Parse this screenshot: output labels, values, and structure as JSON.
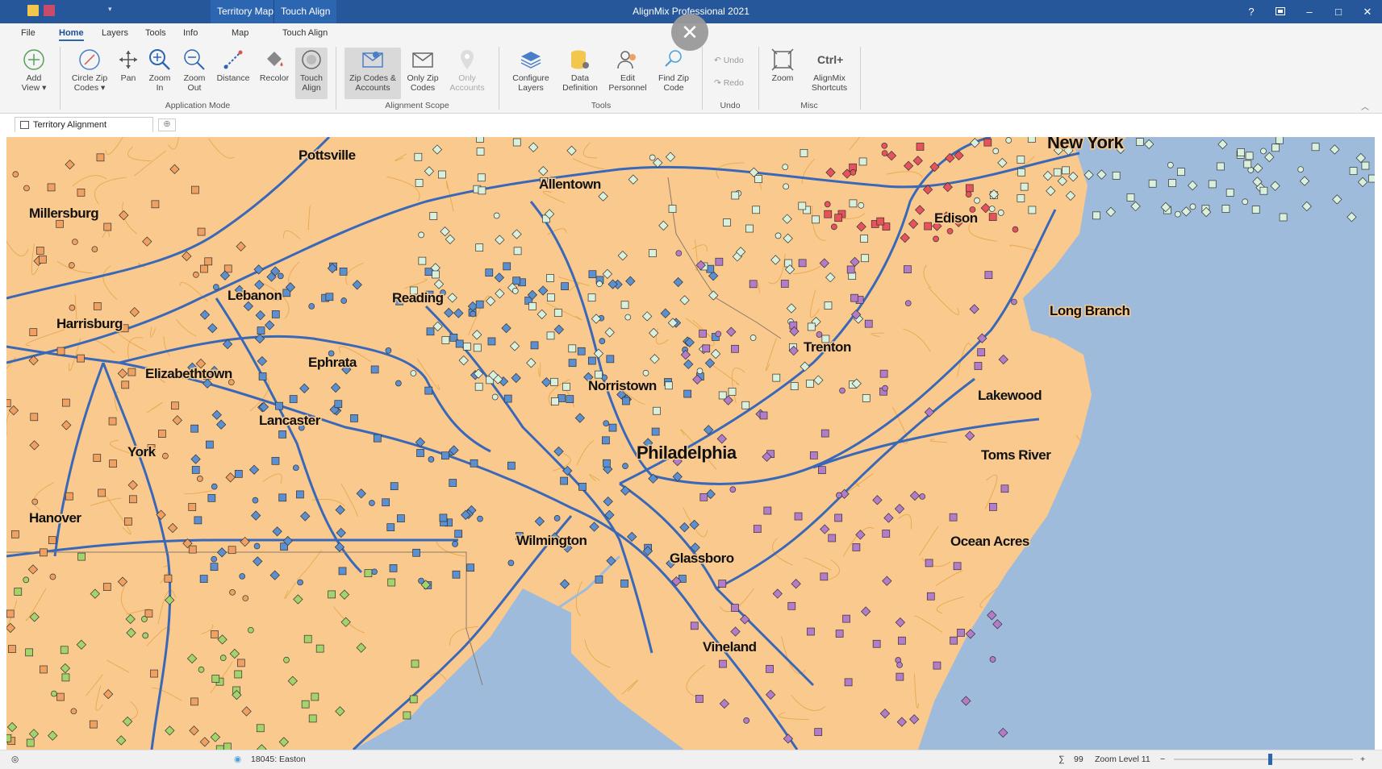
{
  "window": {
    "title": "AlignMix Professional 2021",
    "context_tabs": [
      "Territory Map",
      "Touch Align"
    ],
    "controls": {
      "help": "?",
      "restore_icon": "restore-icon",
      "minimize": "–",
      "maximize": "□",
      "close": "✕"
    }
  },
  "menu": {
    "items": [
      "File",
      "Home",
      "Layers",
      "Tools",
      "Info",
      "Map",
      "Touch Align"
    ],
    "active": "Home"
  },
  "ribbon": {
    "buttons": {
      "add_view": "Add View ▾",
      "circle_zip": "Circle Zip Codes ▾",
      "pan": "Pan",
      "zoom_in": "Zoom In",
      "zoom_out": "Zoom Out",
      "distance": "Distance",
      "recolor": "Recolor",
      "touch_align": "Touch Align",
      "zip_accounts": "Zip Codes & Accounts",
      "only_zip": "Only Zip Codes",
      "only_accounts": "Only Accounts",
      "configure_layers": "Configure Layers",
      "data_definition": "Data Definition",
      "edit_personnel": "Edit Personnel",
      "find_zip": "Find Zip Code",
      "undo": "Undo",
      "redo": "Redo",
      "zoom": "Zoom",
      "shortcuts": "AlignMix Shortcuts",
      "shortcuts_glyph": "Ctrl+"
    },
    "groups": {
      "application_mode": "Application Mode",
      "alignment_scope": "Alignment Scope",
      "tools": "Tools",
      "undo": "Undo",
      "misc": "Misc"
    }
  },
  "document_tab": {
    "label": "Territory Alignment"
  },
  "map": {
    "colors": {
      "land": "#f9c98e",
      "water": "#9fbbdb",
      "highways": "#3a68b8",
      "roads": "#e8a94e",
      "blue": "#5b8fcf",
      "red": "#e8525a",
      "purple": "#b37bc8",
      "green": "#a5d36b",
      "orange": "#f0a060",
      "mint": "#d8f0dc"
    },
    "cities": [
      "Pottsville",
      "Allentown",
      "New York",
      "Millersburg",
      "Edison",
      "Lebanon",
      "Reading",
      "Long Branch",
      "Harrisburg",
      "Trenton",
      "Ephrata",
      "Elizabethtown",
      "Norristown",
      "Lakewood",
      "Lancaster",
      "Philadelphia",
      "Toms River",
      "York",
      "Hanover",
      "Wilmington",
      "Ocean Acres",
      "Glassboro",
      "Vineland"
    ]
  },
  "status": {
    "location": "18045: Easton",
    "sum_symbol": "∑",
    "count": "99",
    "zoom_level": "Zoom Level 11",
    "zoom_minus": "−",
    "zoom_plus": "+"
  }
}
